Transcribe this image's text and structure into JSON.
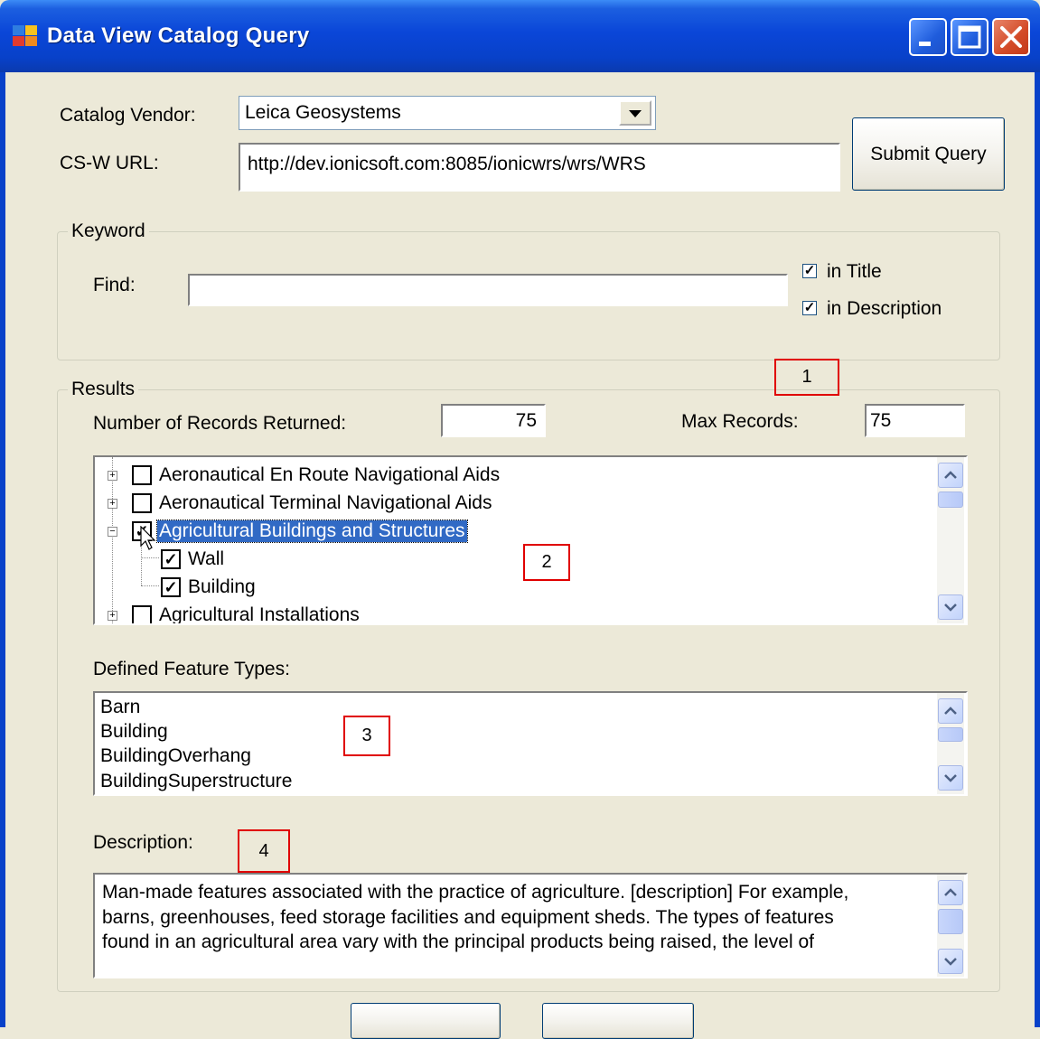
{
  "window": {
    "title": "Data View Catalog Query",
    "minimize_icon": "minimize-icon",
    "maximize_icon": "maximize-icon",
    "close_icon": "close-icon"
  },
  "form": {
    "catalog_vendor_label": "Catalog Vendor:",
    "catalog_vendor_value": "Leica Geosystems",
    "csw_url_label": "CS-W  URL:",
    "csw_url_value": "http://dev.ionicsoft.com:8085/ionicwrs/wrs/WRS",
    "submit_label": "Submit Query"
  },
  "keyword": {
    "group_title": "Keyword",
    "find_label": "Find:",
    "find_value": "",
    "in_title_label": "in Title",
    "in_title_checked": true,
    "in_description_label": "in Description",
    "in_description_checked": true
  },
  "results": {
    "group_title": "Results",
    "records_returned_label": "Number of Records Returned:",
    "records_returned_value": "75",
    "max_records_label": "Max Records:",
    "max_records_value": "75",
    "tree": [
      {
        "label": "Aeronautical En Route Navigational Aids",
        "expander": "+",
        "checked": false
      },
      {
        "label": "Aeronautical Terminal Navigational Aids",
        "expander": "+",
        "checked": false
      },
      {
        "label": "Agricultural Buildings and Structures",
        "expander": "−",
        "checked": true,
        "selected": true
      },
      {
        "label": "Wall",
        "child": true,
        "checked": true
      },
      {
        "label": "Building",
        "child": true,
        "checked": true
      },
      {
        "label": "Agricultural Installations",
        "expander": "+",
        "checked": false
      }
    ],
    "feature_types_label": "Defined Feature Types:",
    "feature_types": [
      "Barn",
      "Building",
      "BuildingOverhang",
      "BuildingSuperstructure"
    ],
    "description_label": "Description:",
    "description_lines": [
      "Man-made features associated with the practice of agriculture. [description] For example,",
      "barns, greenhouses, feed storage facilities and equipment sheds. The types of features",
      "found in an agricultural area vary with the principal products being raised, the level of"
    ]
  },
  "annotations": [
    "1",
    "2",
    "3",
    "4"
  ],
  "colors": {
    "titlebar": "#0841C9",
    "window_bg": "#ECE9D8",
    "selection": "#316AC5",
    "annotation_border": "#e00000"
  }
}
